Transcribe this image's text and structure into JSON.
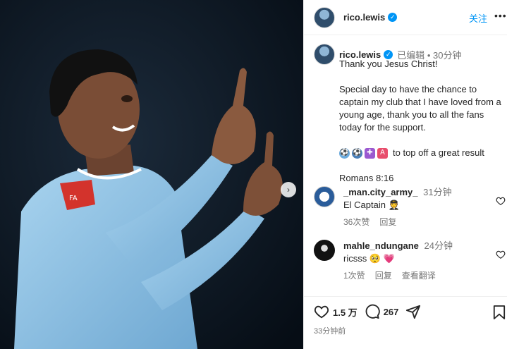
{
  "header": {
    "username": "rico.lewis",
    "follow_label": "关注",
    "more_label": "•••"
  },
  "caption": {
    "username": "rico.lewis",
    "edited_label": "已编辑 • 30分钟",
    "line1": "Thank you Jesus Christ!",
    "line2": "Special day to have the chance to captain my club that I have loved from a young age, thank you to all the fans today for the support.",
    "line3_text": "to top off a great result",
    "line4": "Romans 8:16"
  },
  "comments": [
    {
      "username": "_man.city_army_",
      "time": "31分钟",
      "text": "El Captain 🧑‍✈️",
      "likes": "36次赞",
      "reply": "回复",
      "translate": ""
    },
    {
      "username": "mahle_ndungane",
      "time": "24分钟",
      "text": "ricsss 🥺 💗",
      "likes": "1次赞",
      "reply": "回复",
      "translate": "查看翻译"
    }
  ],
  "actions": {
    "likes": "1.5 万",
    "comments": "267",
    "posted": "33分钟前"
  },
  "colors": {
    "accent": "#0095f6",
    "jersey": "#8fc3e6",
    "background_dark": "#0b1622"
  },
  "icons": [
    "chevron-right-icon",
    "verified-icon",
    "heart-icon",
    "comment-icon",
    "share-icon",
    "bookmark-icon"
  ]
}
